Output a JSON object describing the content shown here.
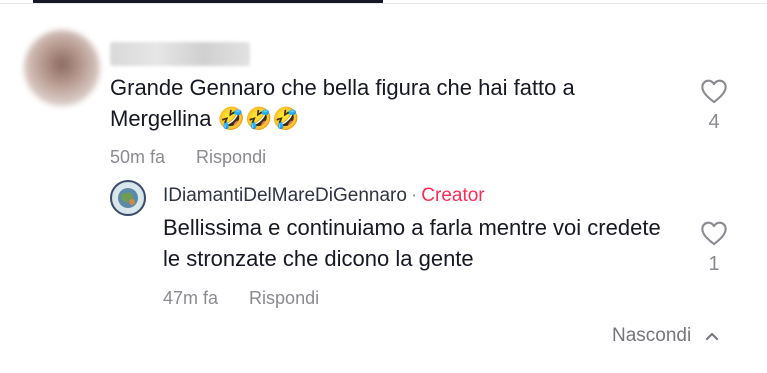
{
  "comment": {
    "text": "Grande Gennaro che bella figura che hai fatto a Mergellina",
    "emojis": "🤣🤣🤣",
    "time": "50m fa",
    "reply_label": "Rispondi",
    "like_count": "4",
    "like_icon": "heart-outline-icon"
  },
  "reply": {
    "username": "IDiamantiDelMareDiGennaro",
    "separator": "·",
    "badge": "Creator",
    "text": "Bellissima e continuiamo a farla mentre voi credete le stronzate che dicono la gente",
    "time": "47m fa",
    "reply_label": "Rispondi",
    "like_count": "1",
    "like_icon": "heart-outline-icon"
  },
  "footer": {
    "hide_label": "Nascondi",
    "hide_icon": "chevron-up-icon"
  },
  "colors": {
    "text": "#161823",
    "muted": "#8a8b91",
    "creator_badge": "#fe2c55",
    "accent_tab": "#161823"
  }
}
